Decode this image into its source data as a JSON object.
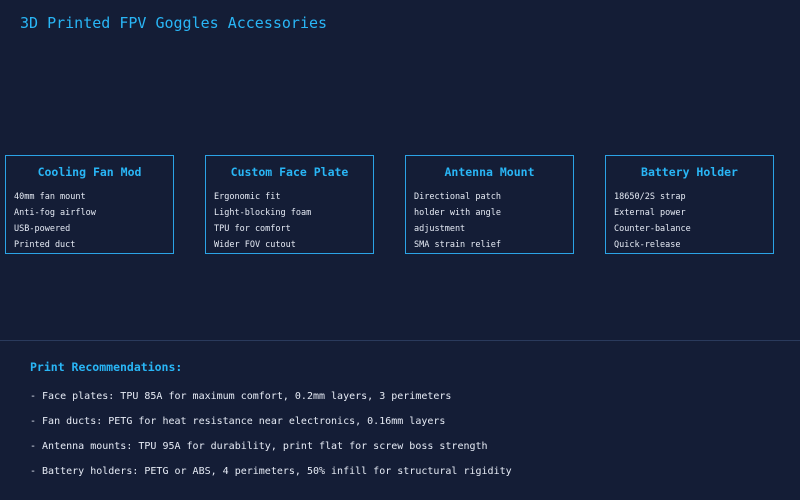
{
  "page": {
    "title": "3D Printed FPV Goggles Accessories"
  },
  "cards": [
    {
      "title": "Cooling Fan Mod",
      "lines": [
        "40mm fan mount",
        "Anti-fog airflow",
        "USB-powered",
        "Printed duct"
      ]
    },
    {
      "title": "Custom Face Plate",
      "lines": [
        "Ergonomic fit",
        "Light-blocking foam",
        "TPU for comfort",
        "Wider FOV cutout"
      ]
    },
    {
      "title": "Antenna Mount",
      "lines": [
        "Directional patch",
        "holder with angle",
        "adjustment",
        "SMA strain relief"
      ]
    },
    {
      "title": "Battery Holder",
      "lines": [
        "18650/2S strap",
        "External power",
        "Counter-balance",
        "Quick-release"
      ]
    }
  ],
  "recommendations": {
    "heading": "Print Recommendations:",
    "items": [
      "- Face plates: TPU 85A for maximum comfort, 0.2mm layers, 3 perimeters",
      "- Fan ducts: PETG for heat resistance near electronics, 0.16mm layers",
      "- Antenna mounts: TPU 95A for durability, print flat for screw boss strength",
      "- Battery holders: PETG or ABS, 4 perimeters, 50% infill for structural rigidity"
    ]
  },
  "colors": {
    "background": "#141d36",
    "accent": "#29b6f6",
    "border": "#2ba3e6",
    "text": "#e6ebf5",
    "divider": "#2a3a5c"
  }
}
